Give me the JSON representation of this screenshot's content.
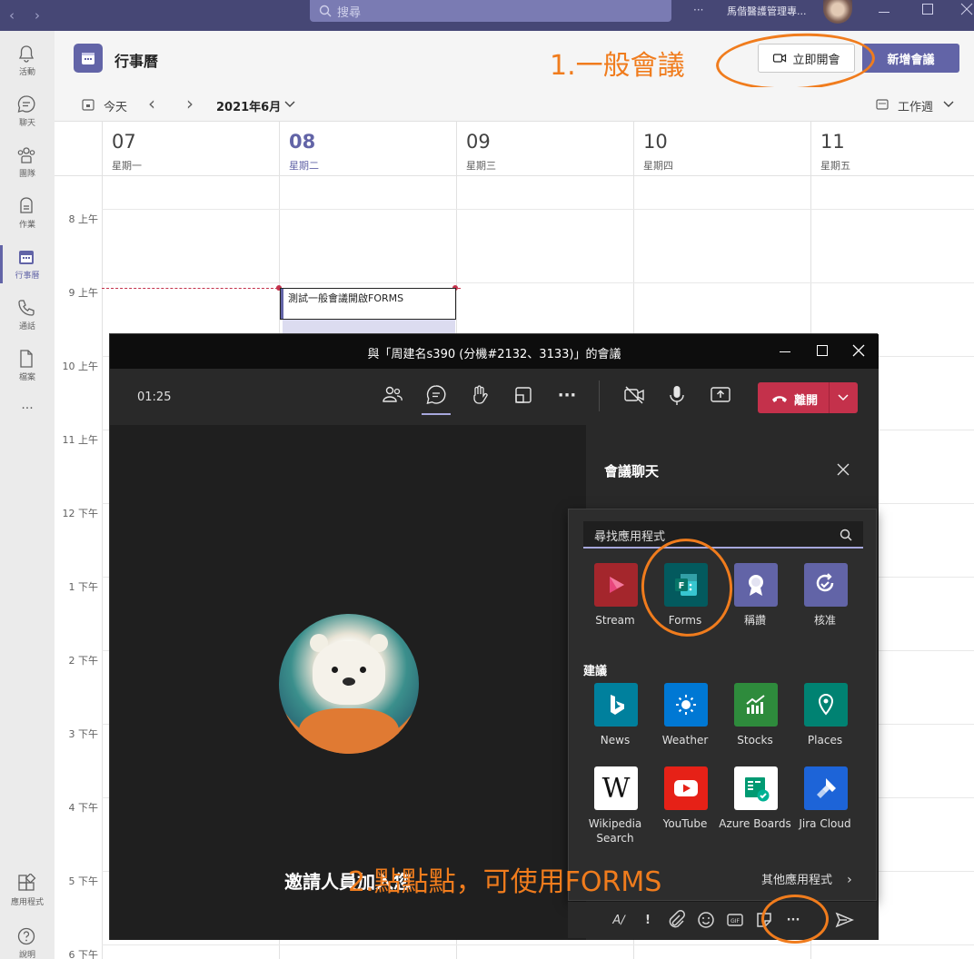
{
  "titlebar": {
    "search_placeholder": "搜尋",
    "org_name": "馬偕醫護管理專...",
    "more": "···"
  },
  "rail": {
    "items": [
      {
        "label": "活動",
        "icon": "bell-icon"
      },
      {
        "label": "聊天",
        "icon": "chat-icon"
      },
      {
        "label": "團隊",
        "icon": "teams-icon"
      },
      {
        "label": "作業",
        "icon": "assignments-icon"
      },
      {
        "label": "行事曆",
        "icon": "calendar-icon",
        "active": true
      },
      {
        "label": "通話",
        "icon": "phone-icon"
      },
      {
        "label": "檔案",
        "icon": "file-icon"
      }
    ],
    "more": "···",
    "apps_label": "應用程式",
    "help_label": "說明"
  },
  "header": {
    "title": "行事曆",
    "meet_now": "立即開會",
    "new_meeting": "新增會議"
  },
  "toolbar": {
    "today": "今天",
    "month": "2021年6月",
    "view": "工作週"
  },
  "days": [
    {
      "num": "07",
      "weekday": "星期一"
    },
    {
      "num": "08",
      "weekday": "星期二",
      "today": true
    },
    {
      "num": "09",
      "weekday": "星期三"
    },
    {
      "num": "10",
      "weekday": "星期四"
    },
    {
      "num": "11",
      "weekday": "星期五"
    }
  ],
  "hours": [
    "8 上午",
    "9 上午",
    "10 上午",
    "11 上午",
    "12 下午",
    "1 下午",
    "2 下午",
    "3 下午",
    "4 下午",
    "5 下午",
    "6 下午"
  ],
  "event": {
    "title": "測試一般會議開啟FORMS"
  },
  "meeting": {
    "title": "與「周建名s390 (分機#2132、3133)」的會議",
    "timer": "01:25",
    "leave": "離開",
    "invite": "邀請人員加入您",
    "chat_title": "會議聊天"
  },
  "apps_popup": {
    "search_placeholder": "尋找應用程式",
    "pinned": [
      {
        "label": "Stream",
        "color": "#a4262c",
        "icon": "stream-icon"
      },
      {
        "label": "Forms",
        "color": "#035a5e",
        "icon": "forms-icon"
      },
      {
        "label": "稱讚",
        "color": "#6264a7",
        "icon": "praise-icon"
      },
      {
        "label": "核准",
        "color": "#6264a7",
        "icon": "approvals-icon"
      }
    ],
    "suggested_label": "建議",
    "suggested": [
      {
        "label": "News",
        "color": "#00809d",
        "icon": "bing-icon"
      },
      {
        "label": "Weather",
        "color": "#0078d4",
        "icon": "sun-icon"
      },
      {
        "label": "Stocks",
        "color": "#2e8b3c",
        "icon": "stocks-icon"
      },
      {
        "label": "Places",
        "color": "#008272",
        "icon": "location-pin-icon"
      },
      {
        "label": "Wikipedia Search",
        "color": "#ffffff",
        "icon": "wikipedia-icon"
      },
      {
        "label": "YouTube",
        "color": "#e62117",
        "icon": "youtube-icon"
      },
      {
        "label": "Azure Boards",
        "color": "#ffffff",
        "icon": "azure-boards-icon"
      },
      {
        "label": "Jira Cloud",
        "color": "#1d64d8",
        "icon": "jira-icon"
      }
    ],
    "more_apps": "其他應用程式"
  },
  "annotations": {
    "one": "1.一般會議",
    "two": "2.點點點，可使用FORMS"
  }
}
